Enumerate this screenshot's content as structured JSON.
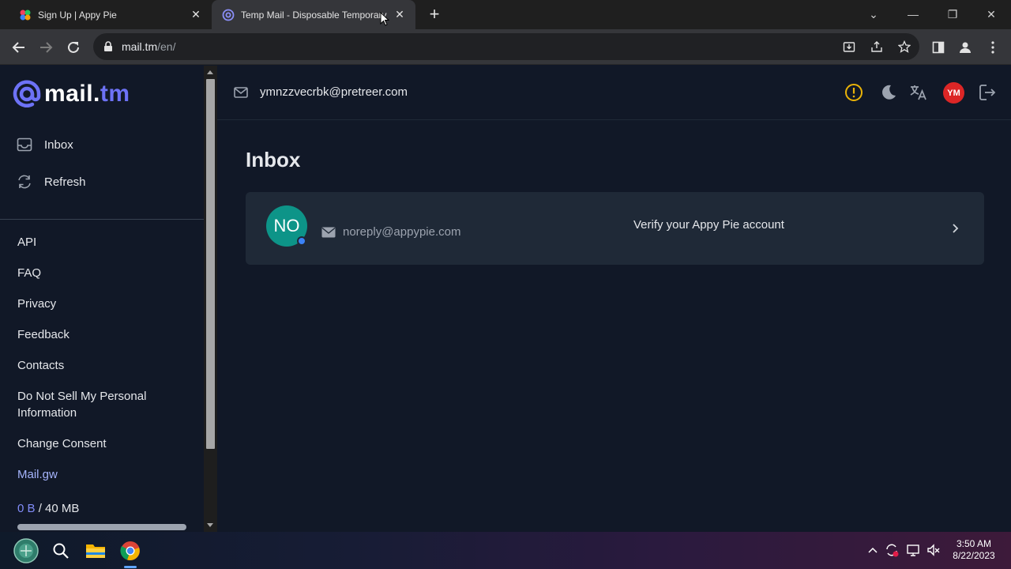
{
  "browser": {
    "tabs": [
      {
        "title": "Sign Up | Appy Pie",
        "active": false
      },
      {
        "title": "Temp Mail - Disposable Temporary E",
        "active": true
      }
    ],
    "url_host": "mail.tm",
    "url_path": "/en/"
  },
  "brand": {
    "name": "mail.",
    "tld": "tm",
    "accent": "#6d72f6"
  },
  "sidebar": {
    "nav": [
      {
        "label": "Inbox",
        "icon": "inbox-icon"
      },
      {
        "label": "Refresh",
        "icon": "refresh-icon"
      }
    ],
    "links": [
      "API",
      "FAQ",
      "Privacy",
      "Feedback",
      "Contacts",
      "Do Not Sell My Personal Information",
      "Change Consent",
      "Mail.gw"
    ],
    "quota_used": "0 B",
    "quota_total": "/ 40 MB"
  },
  "header": {
    "email": "ymnzzvecrbk@pretreer.com",
    "avatar_initials": "YM"
  },
  "inbox": {
    "title": "Inbox",
    "messages": [
      {
        "initials": "NO",
        "from": "noreply@appypie.com",
        "subject": "Verify your Appy Pie account",
        "unread": true
      }
    ]
  },
  "taskbar": {
    "time": "3:50 AM",
    "date": "8/22/2023"
  }
}
